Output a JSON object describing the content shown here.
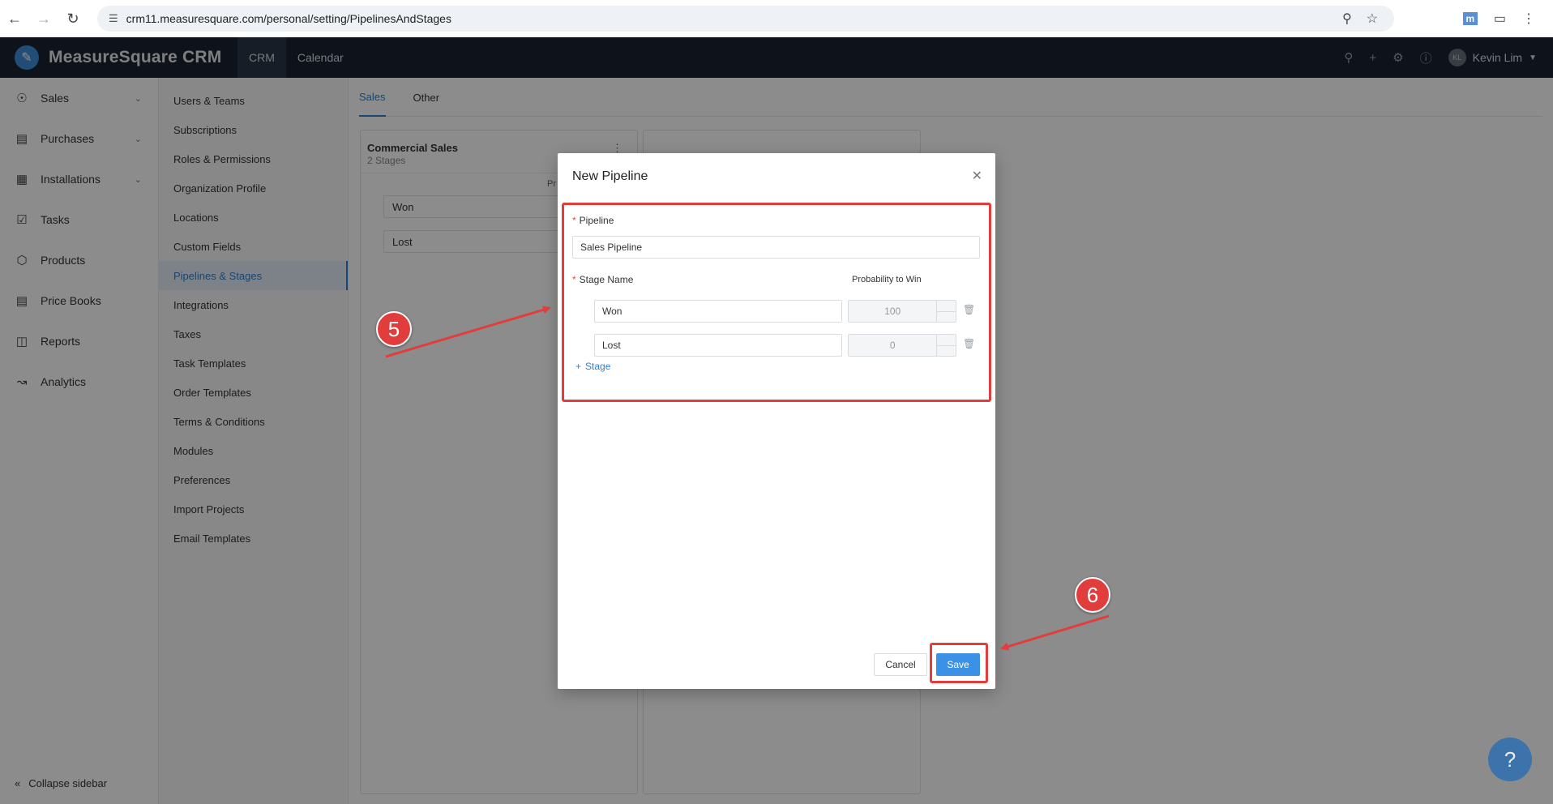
{
  "browser": {
    "url": "crm11.measuresquare.com/personal/setting/PipelinesAndStages"
  },
  "app": {
    "name": "MeasureSquare CRM",
    "tabs": [
      {
        "label": "CRM"
      },
      {
        "label": "Calendar"
      }
    ],
    "user": {
      "initials": "KL",
      "name": "Kevin Lim"
    }
  },
  "sidebar": {
    "items": [
      {
        "label": "Sales",
        "icon": "dollar-icon"
      },
      {
        "label": "Purchases",
        "icon": "receipt-icon"
      },
      {
        "label": "Installations",
        "icon": "installations-icon"
      },
      {
        "label": "Tasks",
        "icon": "calendar-check-icon"
      },
      {
        "label": "Products",
        "icon": "box-icon"
      },
      {
        "label": "Price Books",
        "icon": "book-icon"
      },
      {
        "label": "Reports",
        "icon": "reports-icon"
      },
      {
        "label": "Analytics",
        "icon": "chart-icon"
      }
    ],
    "collapse_label": "Collapse sidebar"
  },
  "settings_menu": {
    "items": [
      {
        "label": "Users & Teams"
      },
      {
        "label": "Subscriptions"
      },
      {
        "label": "Roles & Permissions"
      },
      {
        "label": "Organization Profile"
      },
      {
        "label": "Locations"
      },
      {
        "label": "Custom Fields"
      },
      {
        "label": "Pipelines & Stages"
      },
      {
        "label": "Integrations"
      },
      {
        "label": "Taxes"
      },
      {
        "label": "Task Templates"
      },
      {
        "label": "Order Templates"
      },
      {
        "label": "Terms & Conditions"
      },
      {
        "label": "Modules"
      },
      {
        "label": "Preferences"
      },
      {
        "label": "Import Projects"
      },
      {
        "label": "Email Templates"
      }
    ],
    "active": "Pipelines & Stages"
  },
  "content": {
    "tabs": [
      {
        "label": "Sales"
      },
      {
        "label": "Other"
      }
    ],
    "board": {
      "title": "Commercial Sales",
      "subtitle": "2 Stages",
      "prob_header": "Pr",
      "stages": [
        "Won",
        "Lost"
      ]
    }
  },
  "modal": {
    "title": "New Pipeline",
    "required_mark": "*",
    "pipeline_label": "Pipeline",
    "pipeline_value": "Sales Pipeline",
    "stage_name_label": "Stage Name",
    "probability_label": "Probability to Win",
    "stages": [
      {
        "name": "Won",
        "probability": "100"
      },
      {
        "name": "Lost",
        "probability": "0"
      }
    ],
    "add_stage_label": "Stage",
    "cancel_label": "Cancel",
    "save_label": "Save"
  },
  "annotations": {
    "marker_5": "5",
    "marker_6": "6",
    "color": "#e23d3d"
  },
  "colors": {
    "header_bg": "#1b2332",
    "accent": "#2f80d0",
    "save_button": "#3a91e6"
  }
}
